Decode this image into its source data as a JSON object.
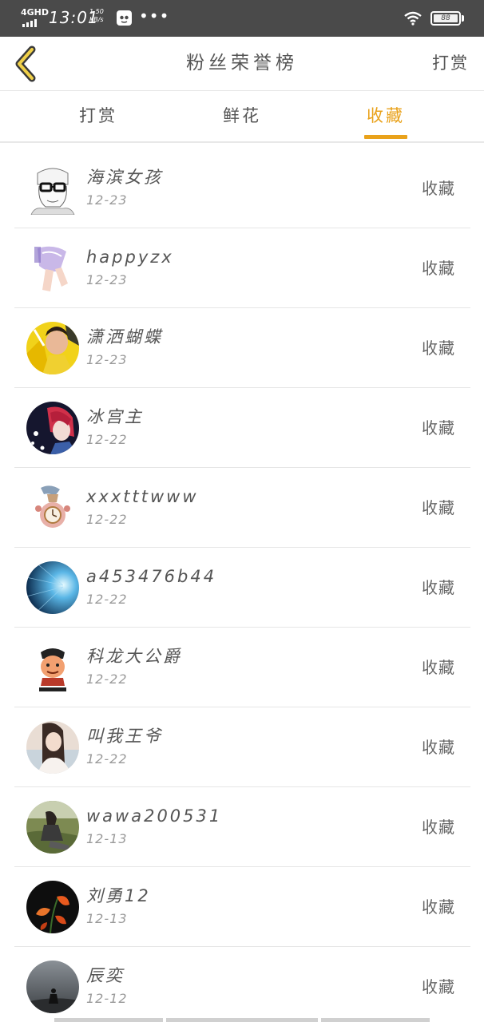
{
  "status_bar": {
    "network": "4GHD",
    "time": "13:01",
    "speed": "1.50",
    "speed_unit": "KB/s",
    "dots": "•••",
    "battery": "88"
  },
  "header": {
    "back_icon": "chevron-left-icon",
    "title": "粉丝荣誉榜",
    "action_label": "打赏"
  },
  "tabs": [
    {
      "label": "打赏",
      "active": false
    },
    {
      "label": "鲜花",
      "active": false
    },
    {
      "label": "收藏",
      "active": true
    }
  ],
  "accent_color": "#e9a21b",
  "fans": [
    {
      "name": "海滨女孩",
      "date": "12-23",
      "action": "收藏"
    },
    {
      "name": "happyzx",
      "date": "12-23",
      "action": "收藏"
    },
    {
      "name": "潇洒蝴蝶",
      "date": "12-23",
      "action": "收藏"
    },
    {
      "name": "冰宫主",
      "date": "12-22",
      "action": "收藏"
    },
    {
      "name": "xxxtttwww",
      "date": "12-22",
      "action": "收藏"
    },
    {
      "name": "a453476b44",
      "date": "12-22",
      "action": "收藏"
    },
    {
      "name": "科龙大公爵",
      "date": "12-22",
      "action": "收藏"
    },
    {
      "name": "叫我王爷",
      "date": "12-22",
      "action": "收藏"
    },
    {
      "name": "wawa200531",
      "date": "12-13",
      "action": "收藏"
    },
    {
      "name": "刘勇12",
      "date": "12-13",
      "action": "收藏"
    },
    {
      "name": "辰奕",
      "date": "12-12",
      "action": "收藏"
    }
  ]
}
